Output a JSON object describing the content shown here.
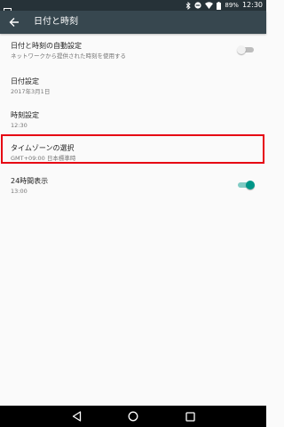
{
  "status_bar": {
    "time": "12:30",
    "battery": "89%",
    "icons": [
      "image-notification-icon",
      "bluetooth-icon",
      "do-not-disturb-icon",
      "wifi-icon",
      "battery-icon"
    ]
  },
  "app_bar": {
    "title": "日付と時刻",
    "back_icon": "arrow-back-icon"
  },
  "settings": [
    {
      "title": "日付と時刻の自動設定",
      "subtitle": "ネットワークから提供された時刻を使用する",
      "toggle": false
    },
    {
      "title": "日付設定",
      "subtitle": "2017年3月1日"
    },
    {
      "title": "時刻設定",
      "subtitle": "12:30"
    },
    {
      "title": "タイムゾーンの選択",
      "subtitle": "GMT+09:00 日本標準時",
      "highlighted": true
    },
    {
      "title": "24時間表示",
      "subtitle": "13:00",
      "toggle": true
    }
  ],
  "nav_bar": {
    "icons": [
      "back-triangle-icon",
      "home-circle-icon",
      "recents-square-icon"
    ]
  },
  "colors": {
    "status_bar": "#263238",
    "app_bar": "#37474f",
    "accent": "#009688",
    "highlight_border": "#e60012",
    "background": "#fafafa"
  }
}
